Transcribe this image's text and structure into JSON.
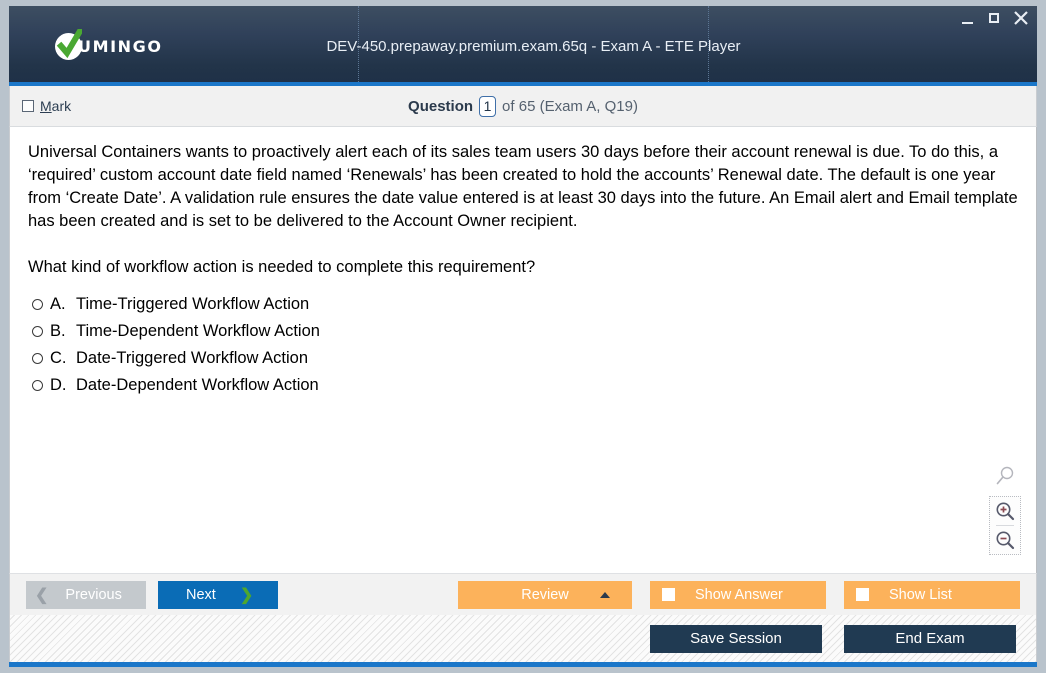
{
  "window": {
    "title": "DEV-450.prepaway.premium.exam.65q - Exam A - ETE Player",
    "logo_text": "UMINGO",
    "minimize_label": "—",
    "maximize_label": "",
    "close_label": "✕",
    "accent_blue": "#1b77c9",
    "titlebar_dark": "#223449"
  },
  "qheader": {
    "mark_label_first": "M",
    "mark_label_rest": "ark",
    "question_word": "Question",
    "question_number": "1",
    "of_text": "of 65 (Exam A, Q19)"
  },
  "question": {
    "body": "Universal Containers wants to proactively alert each of its sales team users 30 days before their account renewal is due. To do this, a ‘required’ custom account date field named ‘Renewals’ has been created to hold the accounts’ Renewal date. The default is one year from ‘Create Date’. A validation rule ensures the date value entered is at least 30 days into the future. An Email alert and Email template has been created and is set to be delivered to the Account Owner recipient.",
    "prompt": "What kind of workflow action is needed to complete this requirement?",
    "options": [
      {
        "letter": "A.",
        "text": "Time-Triggered Workflow Action",
        "selected": false
      },
      {
        "letter": "B.",
        "text": "Time-Dependent Workflow Action",
        "selected": false
      },
      {
        "letter": "C.",
        "text": "Date-Triggered Workflow Action",
        "selected": false
      },
      {
        "letter": "D.",
        "text": "Date-Dependent Workflow Action",
        "selected": false
      }
    ]
  },
  "zoom_tools": {
    "search_icon": "magnifier-icon",
    "zoom_in_icon": "magnifier-plus-icon",
    "zoom_out_icon": "magnifier-minus-icon"
  },
  "toolbar": {
    "previous_label": "Previous",
    "previous_chevron": "❮",
    "previous_enabled": false,
    "next_label": "Next",
    "next_chevron": "❯",
    "review_label": "Review",
    "show_answer_label": "Show Answer",
    "show_list_label": "Show List",
    "orange": "#fcb25b",
    "next_blue": "#0a6cb6"
  },
  "bottombar": {
    "save_session_label": "Save Session",
    "end_exam_label": "End Exam",
    "dark": "#203a52"
  }
}
